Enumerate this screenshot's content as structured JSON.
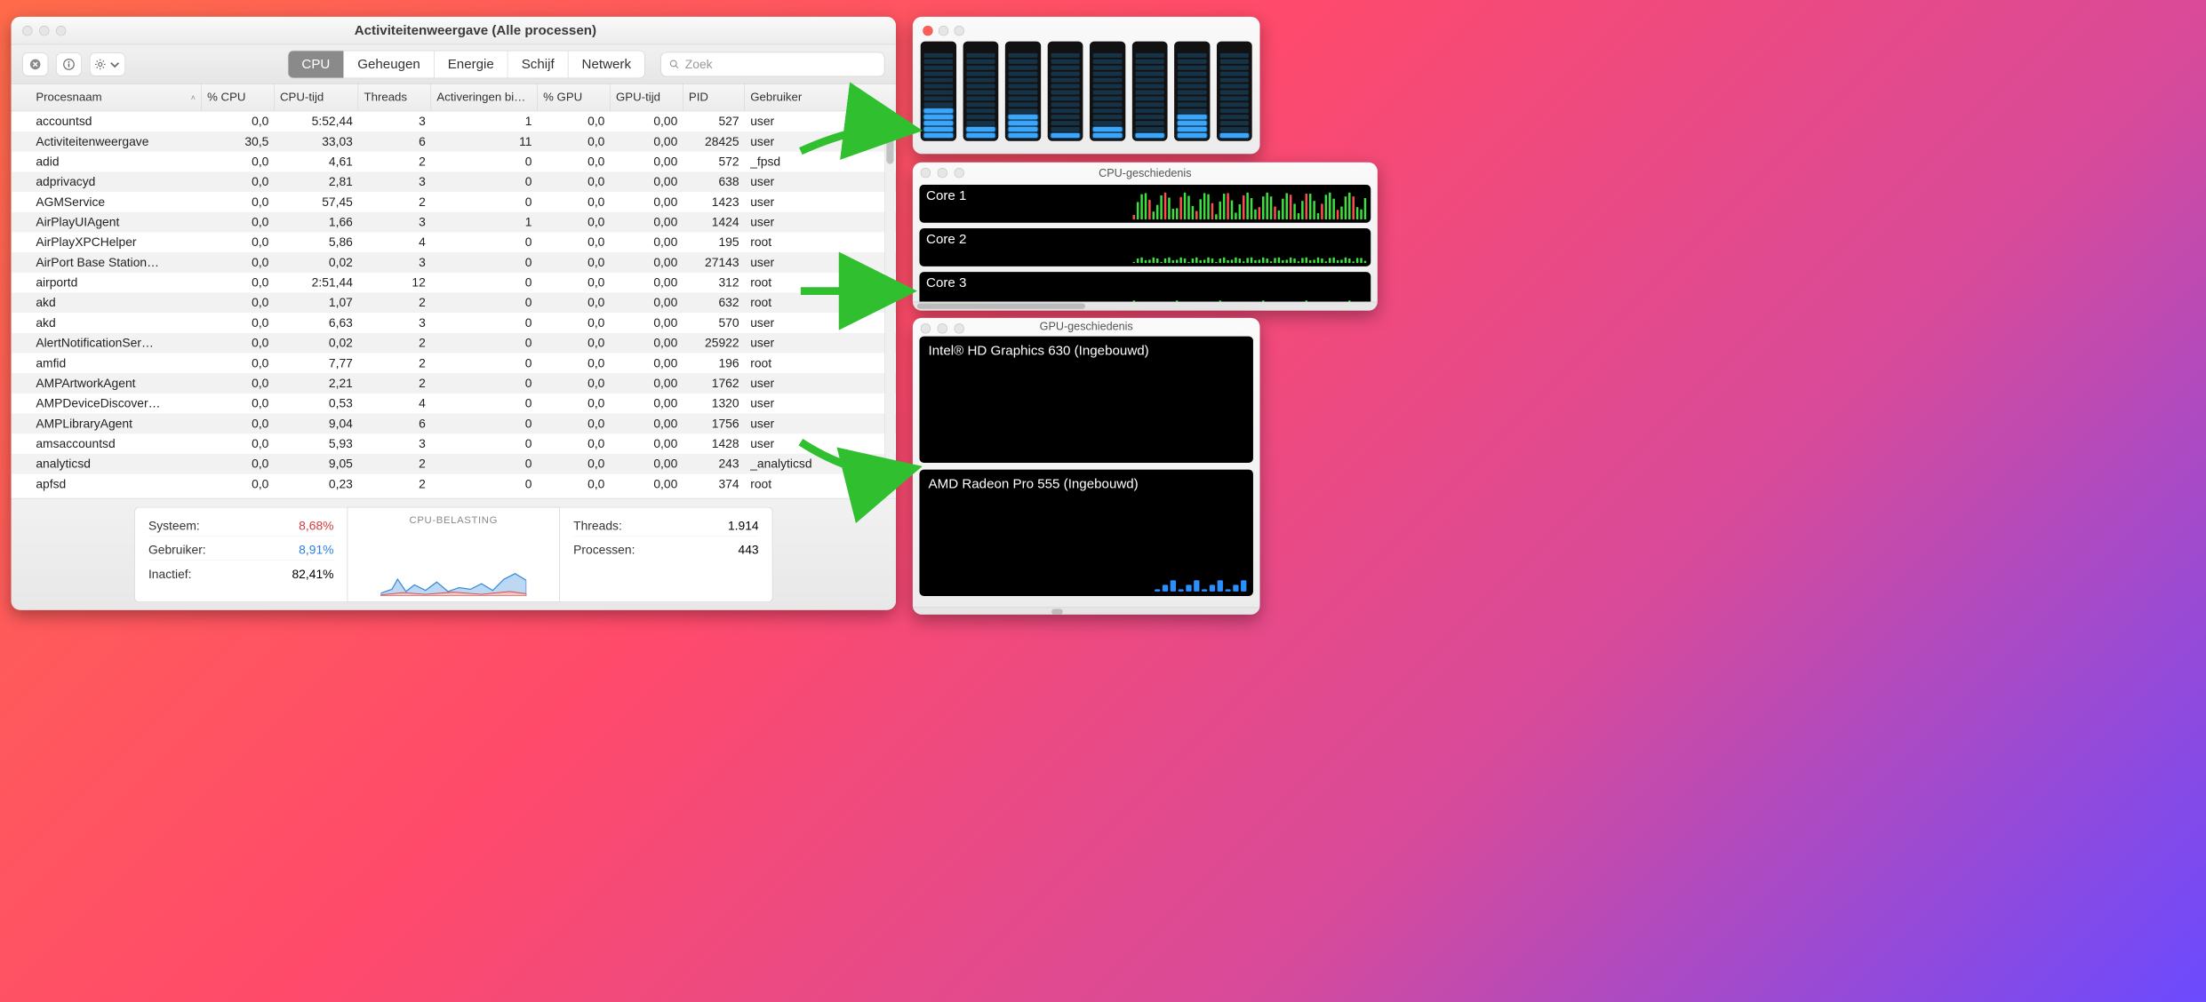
{
  "mainWindow": {
    "title": "Activiteitenweergave (Alle processen)",
    "searchPlaceholder": "Zoek",
    "tabs": [
      "CPU",
      "Geheugen",
      "Energie",
      "Schijf",
      "Netwerk"
    ],
    "activeTab": 0,
    "columns": [
      "Procesnaam",
      "% CPU",
      "CPU-tijd",
      "Threads",
      "Activeringen bi…",
      "% GPU",
      "GPU-tijd",
      "PID",
      "Gebruiker"
    ],
    "sortColumn": 0,
    "rows": [
      {
        "name": "accountsd",
        "cpu": "0,0",
        "cput": "5:52,44",
        "thr": "3",
        "act": "1",
        "gpu": "0,0",
        "gput": "0,00",
        "pid": "527",
        "user": "user"
      },
      {
        "name": "Activiteitenweergave",
        "cpu": "30,5",
        "cput": "33,03",
        "thr": "6",
        "act": "11",
        "gpu": "0,0",
        "gput": "0,00",
        "pid": "28425",
        "user": "user",
        "icon": "activity"
      },
      {
        "name": "adid",
        "cpu": "0,0",
        "cput": "4,61",
        "thr": "2",
        "act": "0",
        "gpu": "0,0",
        "gput": "0,00",
        "pid": "572",
        "user": "_fpsd"
      },
      {
        "name": "adprivacyd",
        "cpu": "0,0",
        "cput": "2,81",
        "thr": "3",
        "act": "0",
        "gpu": "0,0",
        "gput": "0,00",
        "pid": "638",
        "user": "user"
      },
      {
        "name": "AGMService",
        "cpu": "0,0",
        "cput": "57,45",
        "thr": "2",
        "act": "0",
        "gpu": "0,0",
        "gput": "0,00",
        "pid": "1423",
        "user": "user"
      },
      {
        "name": "AirPlayUIAgent",
        "cpu": "0,0",
        "cput": "1,66",
        "thr": "3",
        "act": "1",
        "gpu": "0,0",
        "gput": "0,00",
        "pid": "1424",
        "user": "user",
        "icon": "airplay"
      },
      {
        "name": "AirPlayXPCHelper",
        "cpu": "0,0",
        "cput": "5,86",
        "thr": "4",
        "act": "0",
        "gpu": "0,0",
        "gput": "0,00",
        "pid": "195",
        "user": "root"
      },
      {
        "name": "AirPort Base Station…",
        "cpu": "0,0",
        "cput": "0,02",
        "thr": "3",
        "act": "0",
        "gpu": "0,0",
        "gput": "0,00",
        "pid": "27143",
        "user": "user"
      },
      {
        "name": "airportd",
        "cpu": "0,0",
        "cput": "2:51,44",
        "thr": "12",
        "act": "0",
        "gpu": "0,0",
        "gput": "0,00",
        "pid": "312",
        "user": "root"
      },
      {
        "name": "akd",
        "cpu": "0,0",
        "cput": "1,07",
        "thr": "2",
        "act": "0",
        "gpu": "0,0",
        "gput": "0,00",
        "pid": "632",
        "user": "root"
      },
      {
        "name": "akd",
        "cpu": "0,0",
        "cput": "6,63",
        "thr": "3",
        "act": "0",
        "gpu": "0,0",
        "gput": "0,00",
        "pid": "570",
        "user": "user"
      },
      {
        "name": "AlertNotificationSer…",
        "cpu": "0,0",
        "cput": "0,02",
        "thr": "2",
        "act": "0",
        "gpu": "0,0",
        "gput": "0,00",
        "pid": "25922",
        "user": "user"
      },
      {
        "name": "amfid",
        "cpu": "0,0",
        "cput": "7,77",
        "thr": "2",
        "act": "0",
        "gpu": "0,0",
        "gput": "0,00",
        "pid": "196",
        "user": "root"
      },
      {
        "name": "AMPArtworkAgent",
        "cpu": "0,0",
        "cput": "2,21",
        "thr": "2",
        "act": "0",
        "gpu": "0,0",
        "gput": "0,00",
        "pid": "1762",
        "user": "user"
      },
      {
        "name": "AMPDeviceDiscover…",
        "cpu": "0,0",
        "cput": "0,53",
        "thr": "4",
        "act": "0",
        "gpu": "0,0",
        "gput": "0,00",
        "pid": "1320",
        "user": "user"
      },
      {
        "name": "AMPLibraryAgent",
        "cpu": "0,0",
        "cput": "9,04",
        "thr": "6",
        "act": "0",
        "gpu": "0,0",
        "gput": "0,00",
        "pid": "1756",
        "user": "user"
      },
      {
        "name": "amsaccountsd",
        "cpu": "0,0",
        "cput": "5,93",
        "thr": "3",
        "act": "0",
        "gpu": "0,0",
        "gput": "0,00",
        "pid": "1428",
        "user": "user"
      },
      {
        "name": "analyticsd",
        "cpu": "0,0",
        "cput": "9,05",
        "thr": "2",
        "act": "0",
        "gpu": "0,0",
        "gput": "0,00",
        "pid": "243",
        "user": "_analyticsd"
      },
      {
        "name": "apfsd",
        "cpu": "0,0",
        "cput": "0,23",
        "thr": "2",
        "act": "0",
        "gpu": "0,0",
        "gput": "0,00",
        "pid": "374",
        "user": "root"
      }
    ],
    "footer": {
      "systemLabel": "Systeem:",
      "systemValue": "8,68%",
      "userLabel": "Gebruiker:",
      "userValue": "8,91%",
      "idleLabel": "Inactief:",
      "idleValue": "82,41%",
      "chartTitle": "CPU-BELASTING",
      "threadsLabel": "Threads:",
      "threadsValue": "1.914",
      "processesLabel": "Processen:",
      "processesValue": "443"
    }
  },
  "cpuBars": {
    "segmentsPerCore": 14,
    "coresOn": [
      5,
      2,
      4,
      1,
      2,
      1,
      4,
      1
    ]
  },
  "cpuHistory": {
    "title": "CPU-geschiedenis",
    "cores": [
      "Core 1",
      "Core 2",
      "Core 3"
    ]
  },
  "gpuHistory": {
    "title": "GPU-geschiedenis",
    "gpus": [
      "Intel® HD Graphics 630 (Ingebouwd)",
      "AMD Radeon Pro 555 (Ingebouwd)"
    ]
  }
}
